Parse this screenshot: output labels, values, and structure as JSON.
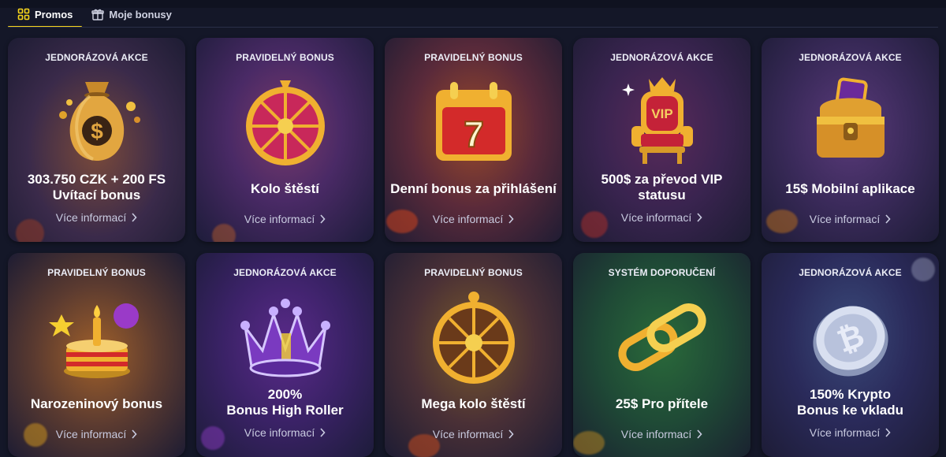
{
  "tabs": [
    {
      "label": "Promos",
      "icon": "grid-icon",
      "active": true
    },
    {
      "label": "Moje bonusy",
      "icon": "gift-icon",
      "active": false
    }
  ],
  "more_label": "Více informací",
  "accent": "#f7d51a",
  "cards": [
    {
      "category": "JEDNORÁZOVÁ AKCE",
      "title": "303.750 CZK + 200 FS\nUvítací bonus",
      "icon": "money-bag-icon",
      "theme": "orange"
    },
    {
      "category": "PRAVIDELNÝ BONUS",
      "title": "Kolo štěstí",
      "icon": "fortune-wheel-icon",
      "theme": "purple"
    },
    {
      "category": "PRAVIDELNÝ BONUS",
      "title": "Denní bonus za přihlášení",
      "icon": "calendar-icon",
      "theme": "orange"
    },
    {
      "category": "JEDNORÁZOVÁ AKCE",
      "title": "500$ za převod VIP\nstatusu",
      "icon": "vip-throne-icon",
      "theme": "purple"
    },
    {
      "category": "JEDNORÁZOVÁ AKCE",
      "title": "15$ Mobilní aplikace",
      "icon": "treasure-chest-icon",
      "theme": "purple"
    },
    {
      "category": "PRAVIDELNÝ BONUS",
      "title": "Narozeninový bonus",
      "icon": "birthday-cake-icon",
      "theme": "orange"
    },
    {
      "category": "JEDNORÁZOVÁ AKCE",
      "title": "200%\nBonus High Roller",
      "icon": "crown-icon",
      "theme": "purple"
    },
    {
      "category": "PRAVIDELNÝ BONUS",
      "title": "Mega kolo štěstí",
      "icon": "mega-wheel-icon",
      "theme": "orange"
    },
    {
      "category": "SYSTÉM DOPORUČENÍ",
      "title": "25$ Pro přítele",
      "icon": "chain-link-icon",
      "theme": "green"
    },
    {
      "category": "JEDNORÁZOVÁ AKCE",
      "title": "150% Krypto\nBonus ke vkladu",
      "icon": "crypto-coin-icon",
      "theme": "purple"
    }
  ]
}
